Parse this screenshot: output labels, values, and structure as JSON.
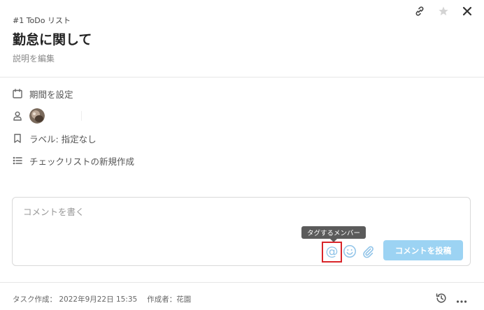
{
  "header": {
    "breadcrumb": "#1 ToDo リスト",
    "title": "勤怠に関して",
    "description_link": "説明を編集"
  },
  "properties": {
    "due_date_label": "期間を設定",
    "label_text": "ラベル: 指定なし",
    "checklist_label": "チェックリストの新規作成"
  },
  "comment": {
    "placeholder": "コメントを書く",
    "mention_tooltip": "タグするメンバー",
    "mention_symbol": "@",
    "post_button": "コメントを投稿"
  },
  "footer": {
    "created_label": "タスク作成：",
    "created_date": "2022年9月22日 15:35",
    "author_label": "作成者：花園"
  },
  "icons": {
    "top": [
      "link-icon",
      "star-icon",
      "close-icon"
    ],
    "props": [
      "calendar-icon",
      "person-icon",
      "bookmark-icon",
      "checklist-icon"
    ],
    "footer": [
      "history-icon",
      "more-icon"
    ]
  },
  "colors": {
    "accent_light": "#9cd3f3",
    "highlight": "#d9252a",
    "tooltip_bg": "#5b5b5b",
    "attach_blue": "#4a90d9"
  }
}
